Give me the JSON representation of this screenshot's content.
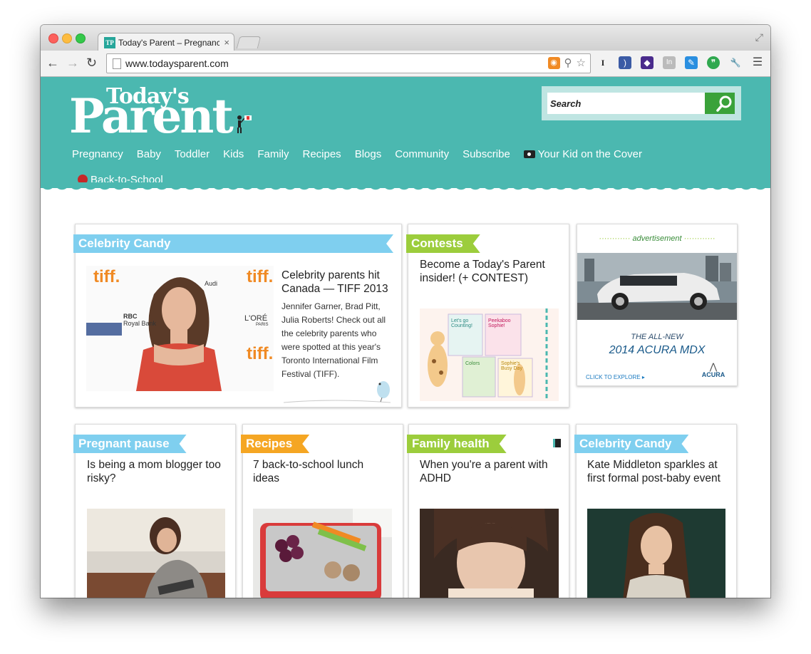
{
  "browser": {
    "tab_title": "Today's Parent – Pregnancy",
    "tab_favicon": "TP",
    "tab_close": "×",
    "url": "www.todaysparent.com",
    "nav_icons": {
      "back": "←",
      "forward": "→",
      "reload": "↻"
    },
    "omnibox_icons": [
      "rss-icon",
      "search-icon",
      "star-icon"
    ],
    "extension_icons": [
      "instapaper-icon",
      "feed-icon",
      "shield-icon",
      "linkedin-icon",
      "pencil-icon",
      "hangouts-icon",
      "wrench-icon",
      "menu-icon"
    ]
  },
  "site": {
    "logo_top": "Today's",
    "logo_bottom": "Parent",
    "search_placeholder": "Search",
    "nav": [
      "Pregnancy",
      "Baby",
      "Toddler",
      "Kids",
      "Family",
      "Recipes",
      "Blogs",
      "Community",
      "Subscribe",
      "Your Kid on the Cover",
      "Back-to-School"
    ],
    "brand_color": "#4bb8b0"
  },
  "cards": {
    "feature": {
      "category": "Celebrity Candy",
      "category_color": "#7fcfef",
      "headline": "Celebrity parents hit Canada — TIFF 2013",
      "blurb": "Jennifer Garner, Brad Pitt, Julia Roberts! Check out all the celebrity parents who were spotted at this year's Toronto International Film Festival (TIFF).",
      "backdrop_text": [
        "tiff.",
        "Audi",
        "RBC",
        "Royal Bank",
        "L'ORÉ",
        "PARIS"
      ]
    },
    "contest": {
      "category": "Contests",
      "category_color": "#9ccd3c",
      "headline": "Become a Today's Parent insider! (+ CONTEST)",
      "book_titles": [
        "Let's go Counting!",
        "Peekaboo Sophie!",
        "Colors",
        "Sophie's Busy Day"
      ]
    },
    "ad": {
      "label": "advertisement",
      "line1": "THE ALL-NEW",
      "line2": "2014 ACURA MDX",
      "cta": "CLICK TO EXPLORE ▸",
      "brand": "ACURA"
    },
    "row2": [
      {
        "category": "Pregnant pause",
        "color": "#7fcfef",
        "headline": "Is being a mom blogger too risky?"
      },
      {
        "category": "Recipes",
        "color": "#f5a623",
        "headline": "7 back-to-school lunch ideas"
      },
      {
        "category": "Family health",
        "color": "#9ccd3c",
        "headline": "When you're a parent with ADHD"
      },
      {
        "category": "Celebrity Candy",
        "color": "#7fcfef",
        "headline": "Kate Middleton sparkles at first formal post-baby event"
      }
    ]
  }
}
